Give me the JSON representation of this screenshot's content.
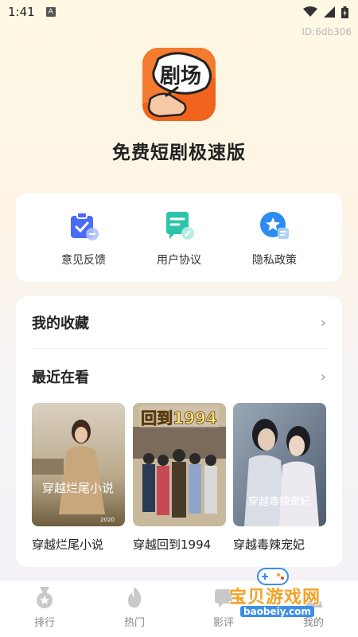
{
  "status_bar": {
    "time": "1:41",
    "indicator": "A"
  },
  "app": {
    "id_text": "ID:6db306",
    "logo_text": "剧场",
    "title": "免费短剧极速版"
  },
  "quick_links": [
    {
      "label": "意见反馈",
      "icon": "feedback-clipboard-icon"
    },
    {
      "label": "用户协议",
      "icon": "agreement-document-icon"
    },
    {
      "label": "隐私政策",
      "icon": "privacy-badge-icon"
    }
  ],
  "collection": {
    "favorites_label": "我的收藏",
    "recent_label": "最近在看",
    "chevron": "›"
  },
  "recent_dramas": [
    {
      "title": "穿越烂尾小说",
      "poster_text": "穿越烂尾小说",
      "poster_year": "2020"
    },
    {
      "title": "穿越回到1994",
      "poster_text": "回到1994"
    },
    {
      "title": "穿越毒辣宠妃",
      "poster_text": "穿越毒辣宠妃"
    }
  ],
  "bottom_nav": [
    {
      "label": "排行",
      "icon": "ranking-medal-icon"
    },
    {
      "label": "热门",
      "icon": "flame-icon"
    },
    {
      "label": "影评",
      "icon": "review-icon"
    },
    {
      "label": "我的",
      "icon": "profile-icon"
    }
  ],
  "watermark": {
    "main": "宝贝游戏网",
    "sub": "baobeiy.com"
  },
  "colors": {
    "accent_blue": "#4a6cf7",
    "logo_orange": "#f0641e",
    "watermark_orange": "#f1a325"
  }
}
